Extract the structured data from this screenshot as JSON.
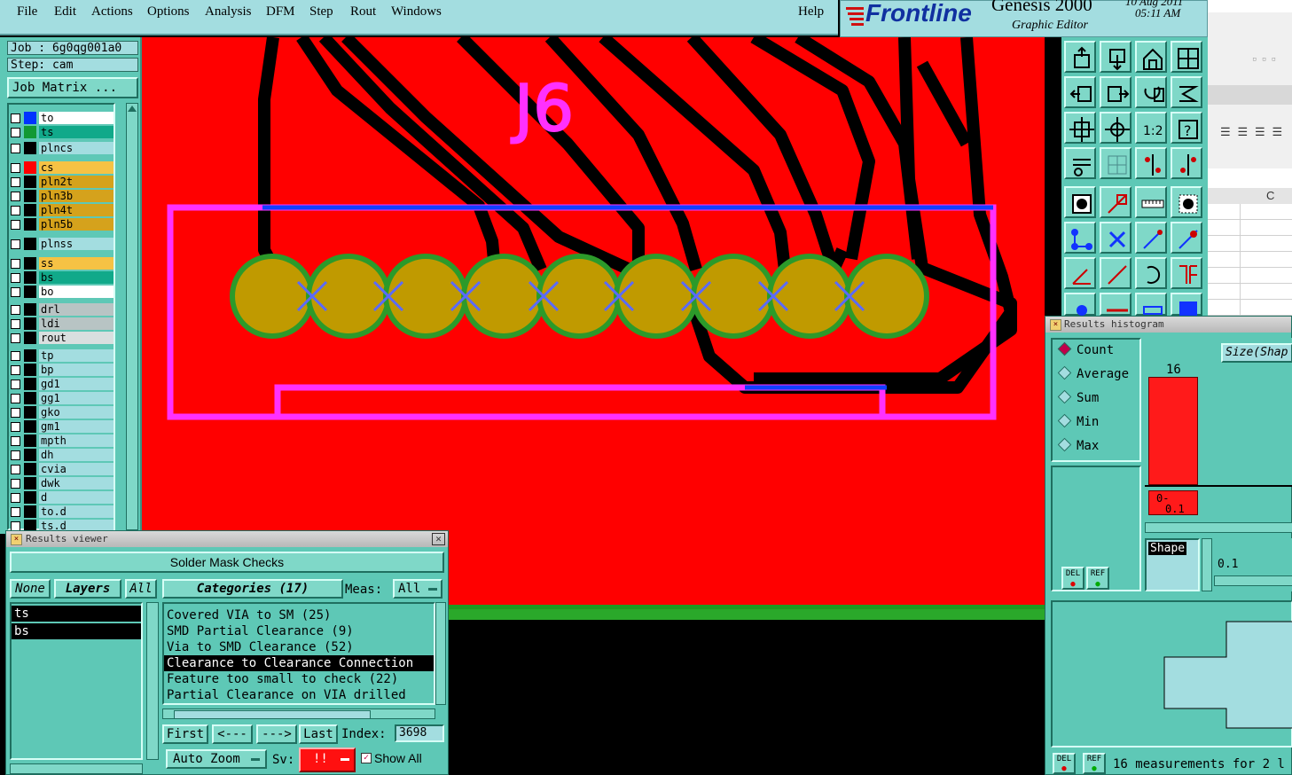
{
  "menubar": {
    "items": [
      "File",
      "Edit",
      "Actions",
      "Options",
      "Analysis",
      "DFM",
      "Step",
      "Rout",
      "Windows"
    ],
    "help": "Help"
  },
  "brand": {
    "logo_text": "Frontline",
    "product": "Genesis 2000",
    "subtitle": "Graphic Editor",
    "date": "10 Aug 2011",
    "time": "05:11 AM"
  },
  "job": {
    "job_line": "Job : 6g0qg001a0",
    "step_line": "Step: cam",
    "matrix_button": "Job Matrix ..."
  },
  "layers": [
    {
      "name": "to",
      "color": "#0033ff",
      "bg": "#ffffff"
    },
    {
      "name": "ts",
      "color": "#119933",
      "bg": "#11a98a"
    },
    {
      "name": "plncs",
      "color": "#000000",
      "bg": "#a3dde0"
    },
    {
      "name": "cs",
      "color": "#ff0000",
      "bg": "#f6c244"
    },
    {
      "name": "pln2t",
      "color": "#000000",
      "bg": "#d5a21c"
    },
    {
      "name": "pln3b",
      "color": "#000000",
      "bg": "#d5a21c"
    },
    {
      "name": "pln4t",
      "color": "#000000",
      "bg": "#d5a21c"
    },
    {
      "name": "pln5b",
      "color": "#000000",
      "bg": "#d5a21c"
    },
    {
      "name": "plnss",
      "color": "#000000",
      "bg": "#a3dde0"
    },
    {
      "name": "ss",
      "color": "#000000",
      "bg": "#f6c244"
    },
    {
      "name": "bs",
      "color": "#000000",
      "bg": "#11a98a"
    },
    {
      "name": "bo",
      "color": "#000000",
      "bg": "#ffffff"
    },
    {
      "name": "drl",
      "color": "#000000",
      "bg": "#b8c4c4"
    },
    {
      "name": "ldi",
      "color": "#000000",
      "bg": "#b8c4c4"
    },
    {
      "name": "rout",
      "color": "#000000",
      "bg": "#d9dfdf"
    },
    {
      "name": "tp",
      "color": "#000000",
      "bg": "#a3dde0"
    },
    {
      "name": "bp",
      "color": "#000000",
      "bg": "#a3dde0"
    },
    {
      "name": "gd1",
      "color": "#000000",
      "bg": "#a3dde0"
    },
    {
      "name": "gg1",
      "color": "#000000",
      "bg": "#a3dde0"
    },
    {
      "name": "gko",
      "color": "#000000",
      "bg": "#a3dde0"
    },
    {
      "name": "gm1",
      "color": "#000000",
      "bg": "#a3dde0"
    },
    {
      "name": "mpth",
      "color": "#000000",
      "bg": "#a3dde0"
    },
    {
      "name": "dh",
      "color": "#000000",
      "bg": "#a3dde0"
    },
    {
      "name": "cvia",
      "color": "#000000",
      "bg": "#a3dde0"
    },
    {
      "name": "dwk",
      "color": "#000000",
      "bg": "#a3dde0"
    },
    {
      "name": "d",
      "color": "#000000",
      "bg": "#a3dde0"
    },
    {
      "name": "to.d",
      "color": "#000000",
      "bg": "#a3dde0"
    },
    {
      "name": "ts.d",
      "color": "#000000",
      "bg": "#a3dde0"
    }
  ],
  "canvas": {
    "silkscreen_label": "J6"
  },
  "results_viewer": {
    "title": "Results viewer",
    "header": "Solder Mask Checks",
    "none_btn": "None",
    "layers_btn": "Layers",
    "all_btn": "All",
    "categories_btn": "Categories (17)",
    "meas_label": "Meas:",
    "meas_value": "All",
    "layer_list": [
      "ts",
      "bs"
    ],
    "categories": [
      "Covered VIA to SM (25)",
      "SMD Partial Clearance (9)",
      "Via to SMD Clearance (52)",
      "Clearance to Clearance Connection",
      "Feature too small to check (22)",
      "Partial Clearance on VIA drilled"
    ],
    "selected_category_index": 3,
    "first_btn": "First",
    "prev_btn": "<---",
    "next_btn": "--->",
    "last_btn": "Last",
    "index_label": "Index:",
    "index_value": "3698",
    "zoom_value": "Auto Zoom",
    "sv_label": "Sv:",
    "sv_value": "!!",
    "show_all_label": "Show All"
  },
  "histogram": {
    "title": "Results histogram",
    "modes": [
      "Count",
      "Average",
      "Sum",
      "Min",
      "Max"
    ],
    "selected_mode": "Count",
    "size_label": "Size(Shap",
    "bar_count_label": "16",
    "bin_label_1": "0-",
    "bin_label_2": "0.1",
    "shape_label": "Shape",
    "shape_value": "0.1",
    "del_label": "DEL",
    "ref_label": "REF",
    "footer": "16 measurements for 2 l"
  },
  "bg_window": {
    "column_header": "C"
  }
}
